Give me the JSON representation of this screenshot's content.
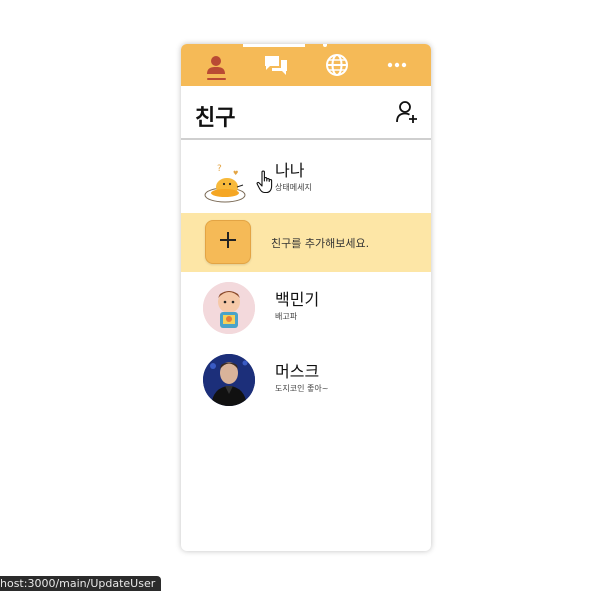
{
  "tabs": [
    {
      "icon": "person-icon",
      "active": true
    },
    {
      "icon": "chat-icon",
      "active": false
    },
    {
      "icon": "globe-icon",
      "active": false
    },
    {
      "icon": "more-icon",
      "active": false
    }
  ],
  "header": {
    "title": "친구"
  },
  "my_profile": {
    "name": "나나",
    "status": "상태메세지"
  },
  "add_friend_prompt": "친구를 추가해보세요.",
  "friends": [
    {
      "name": "백민기",
      "status": "배고파"
    },
    {
      "name": "머스크",
      "status": "도지코인 좋아~"
    }
  ],
  "status_bar_url": "host:3000/main/UpdateUser",
  "colors": {
    "tabbar": "#f5ba57",
    "add_row": "#fde6a6",
    "active_underline": "#b94a34"
  }
}
